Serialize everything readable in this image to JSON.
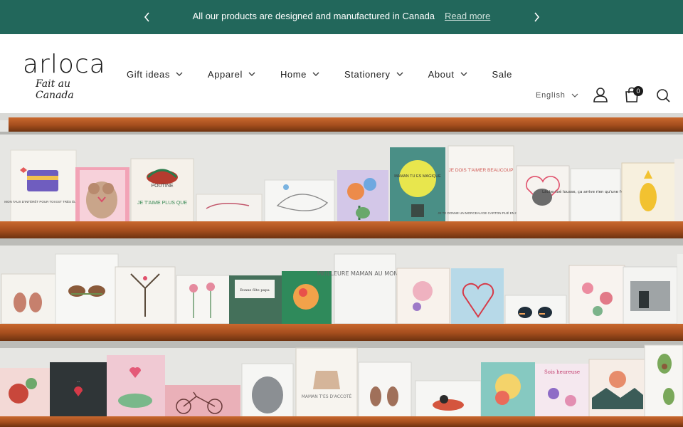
{
  "announcement": {
    "message": "All our products are designed and manufactured in Canada",
    "link_label": "Read more",
    "prev_icon": "chevron-left-icon",
    "next_icon": "chevron-right-icon",
    "background": "#22675b"
  },
  "logo": {
    "wordmark": "arloca",
    "tagline": "Fait au Canada"
  },
  "nav": {
    "items": [
      {
        "label": "Gift ideas",
        "has_dropdown": true
      },
      {
        "label": "Apparel",
        "has_dropdown": true
      },
      {
        "label": "Home",
        "has_dropdown": true
      },
      {
        "label": "Stationery",
        "has_dropdown": true
      },
      {
        "label": "About",
        "has_dropdown": true
      },
      {
        "label": "Sale",
        "has_dropdown": false
      }
    ]
  },
  "header": {
    "language": "English",
    "cart_count": "0",
    "account_icon": "user-icon",
    "cart_icon": "shopping-bag-icon",
    "search_icon": "search-icon"
  },
  "hero": {
    "image": "greeting-card-display-shelves",
    "card_texts": {
      "c1": "MON TAUX D'INTÉRÊT POUR TOI EST TRÈS ÉLEVÉ",
      "c2": "POUTINE",
      "c3": "JE T'AIME PLUS QUE",
      "c4": "MAMAN TU ES MAGIQUE",
      "c5": "JE DOIS T'AIMER BEAUCOUP",
      "c6": "JE TE DONNE UN MORCEAU DE CARTON PLIÉ EN DEUX",
      "c7": "Lâche-toé lousse, ça arrive rien qu'une fois par année.",
      "c8": "MEILLEURE MAMAN AU MONDE...",
      "c9": "Bonne fête papa",
      "c10": "MAMAN T'ES D'ACCOTÉ",
      "c11": "Sois heureuse"
    }
  }
}
